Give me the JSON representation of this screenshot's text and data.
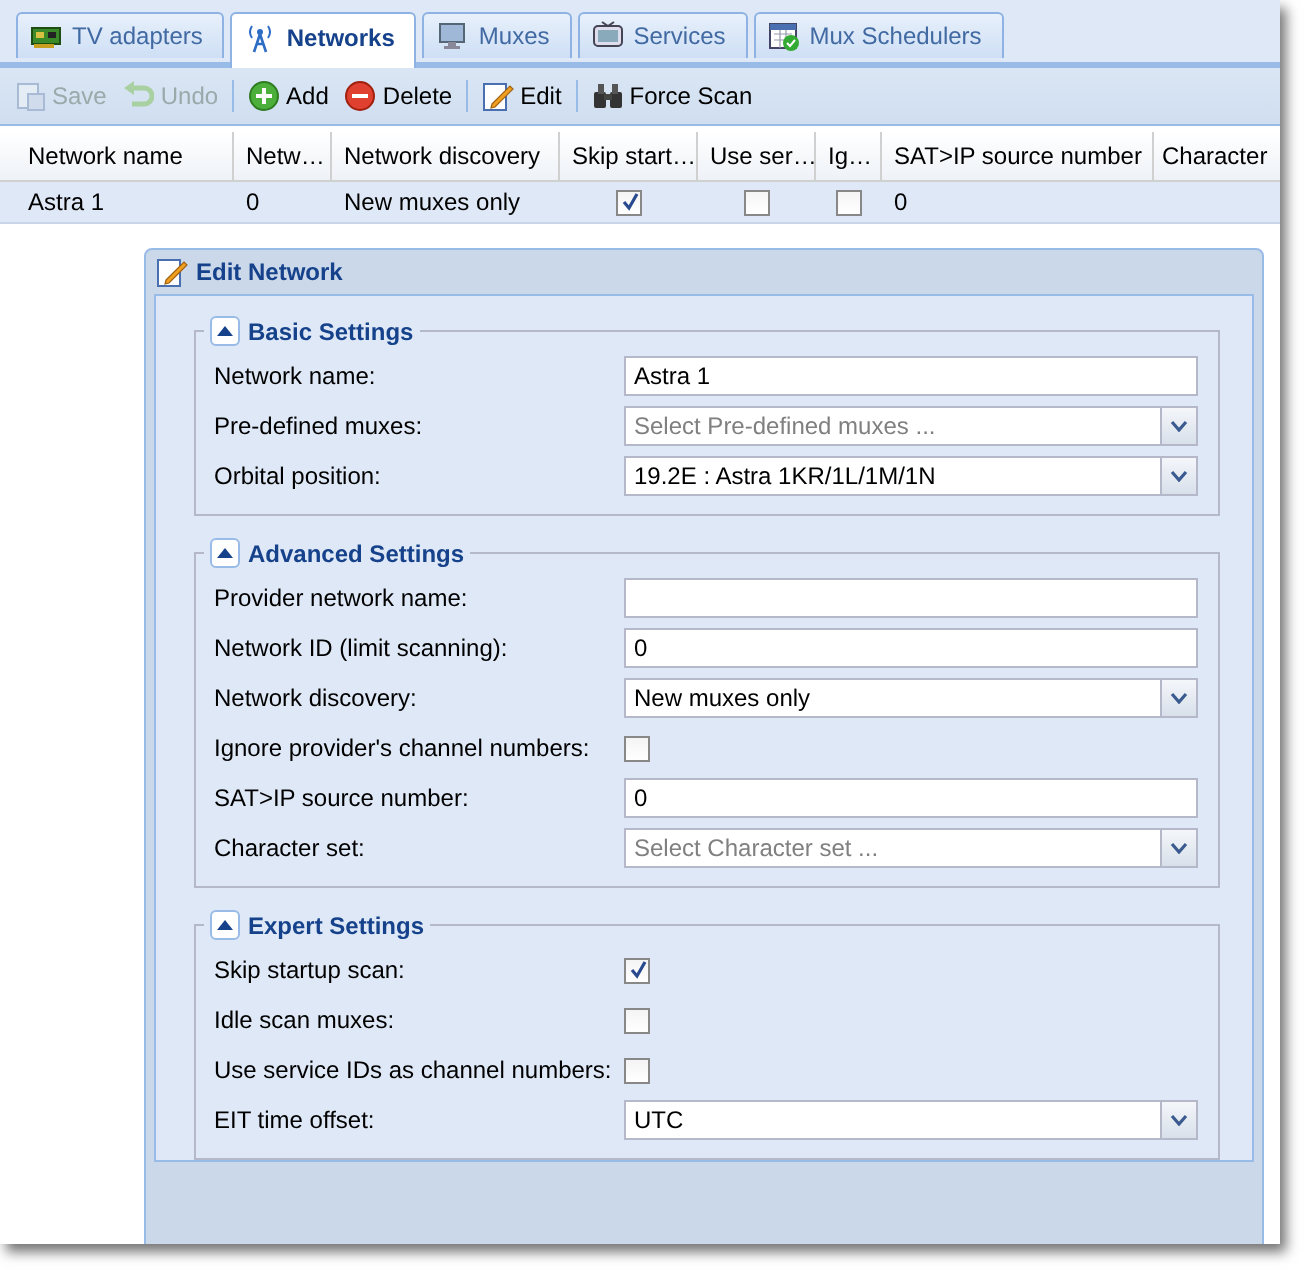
{
  "tabs": [
    {
      "label": "TV adapters",
      "selected": false
    },
    {
      "label": "Networks",
      "selected": true
    },
    {
      "label": "Muxes",
      "selected": false
    },
    {
      "label": "Services",
      "selected": false
    },
    {
      "label": "Mux Schedulers",
      "selected": false
    }
  ],
  "toolbar": [
    {
      "kind": "button",
      "label": "Save",
      "disabled": true
    },
    {
      "kind": "button",
      "label": "Undo",
      "disabled": true
    },
    {
      "kind": "separator"
    },
    {
      "kind": "button",
      "label": "Add",
      "disabled": false
    },
    {
      "kind": "button",
      "label": "Delete",
      "disabled": false
    },
    {
      "kind": "separator"
    },
    {
      "kind": "button",
      "label": "Edit",
      "disabled": false
    },
    {
      "kind": "separator"
    },
    {
      "kind": "button",
      "label": "Force Scan",
      "disabled": false
    }
  ],
  "table": {
    "columns": [
      "Network name",
      "Netw…",
      "Network discovery",
      "Skip start…",
      "Use ser…",
      "Ig…",
      "SAT>IP source number",
      "Character"
    ],
    "rows": [
      {
        "cells": [
          {
            "kind": "text",
            "text": "Astra 1"
          },
          {
            "kind": "text",
            "text": "0"
          },
          {
            "kind": "text",
            "text": "New muxes only"
          },
          {
            "kind": "check",
            "checked": true
          },
          {
            "kind": "check",
            "checked": false
          },
          {
            "kind": "check",
            "checked": false
          },
          {
            "kind": "text",
            "text": "0"
          },
          {
            "kind": "empty"
          }
        ]
      }
    ]
  },
  "dialog": {
    "title": "Edit Network",
    "sections": [
      {
        "title": "Basic Settings",
        "expanded": true,
        "fields": [
          {
            "label": "Network name:",
            "kind": "text",
            "value": "Astra 1"
          },
          {
            "label": "Pre-defined muxes:",
            "kind": "combo",
            "placeholder": "Select Pre-defined muxes ..."
          },
          {
            "label": "Orbital position:",
            "kind": "combo",
            "value": "19.2E : Astra 1KR/1L/1M/1N"
          }
        ]
      },
      {
        "title": "Advanced Settings",
        "expanded": true,
        "fields": [
          {
            "label": "Provider network name:",
            "kind": "text"
          },
          {
            "label": "Network ID (limit scanning):",
            "kind": "text",
            "value": "0"
          },
          {
            "label": "Network discovery:",
            "kind": "combo",
            "value": "New muxes only"
          },
          {
            "label": "Ignore provider's channel numbers:",
            "kind": "check",
            "checked": false
          },
          {
            "label": "SAT>IP source number:",
            "kind": "text",
            "value": "0"
          },
          {
            "label": "Character set:",
            "kind": "combo",
            "placeholder": "Select Character set ..."
          }
        ]
      },
      {
        "title": "Expert Settings",
        "expanded": true,
        "fields": [
          {
            "label": "Skip startup scan:",
            "kind": "check",
            "checked": true
          },
          {
            "label": "Idle scan muxes:",
            "kind": "check",
            "checked": false
          },
          {
            "label": "Use service IDs as channel numbers:",
            "kind": "check",
            "checked": false
          },
          {
            "label": "EIT time offset:",
            "kind": "combo",
            "value": "UTC"
          }
        ]
      }
    ]
  }
}
